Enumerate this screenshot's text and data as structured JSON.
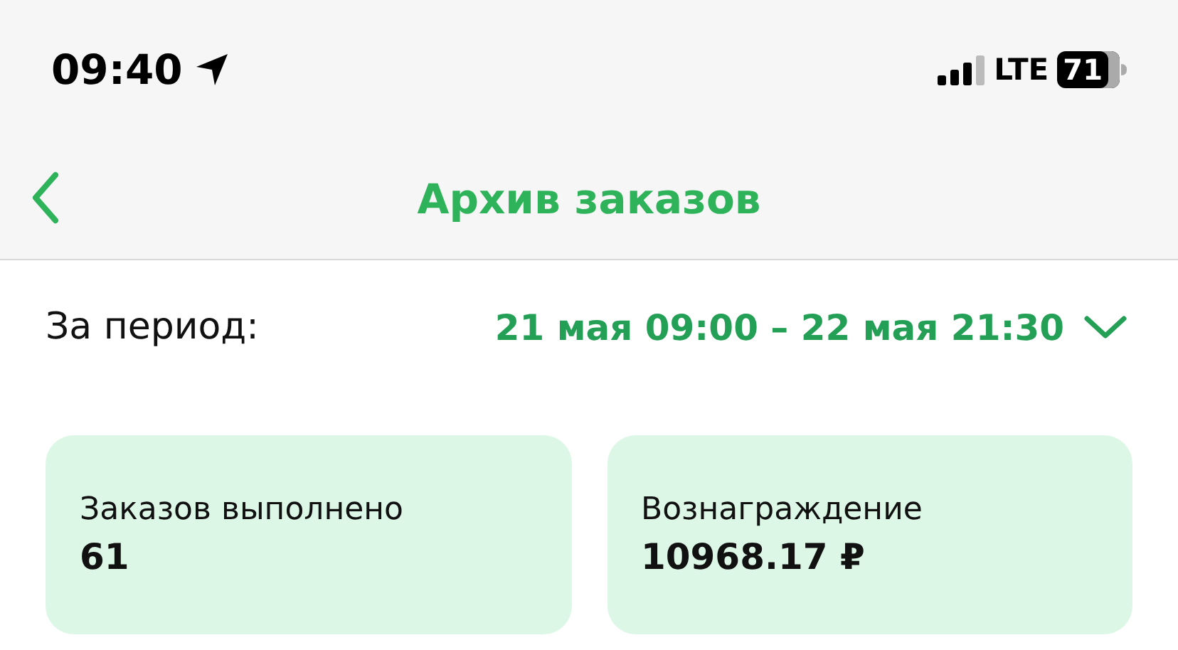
{
  "status_bar": {
    "time": "09:40",
    "network": "LTE",
    "battery": "71"
  },
  "nav_bar": {
    "title": "Архив заказов"
  },
  "period": {
    "label": "За период:",
    "value": "21 мая 09:00 – 22 мая 21:30"
  },
  "cards": [
    {
      "label": "Заказов выполнено",
      "value": "61"
    },
    {
      "label": "Вознаграждение",
      "value": "10968.17 ₽"
    }
  ]
}
